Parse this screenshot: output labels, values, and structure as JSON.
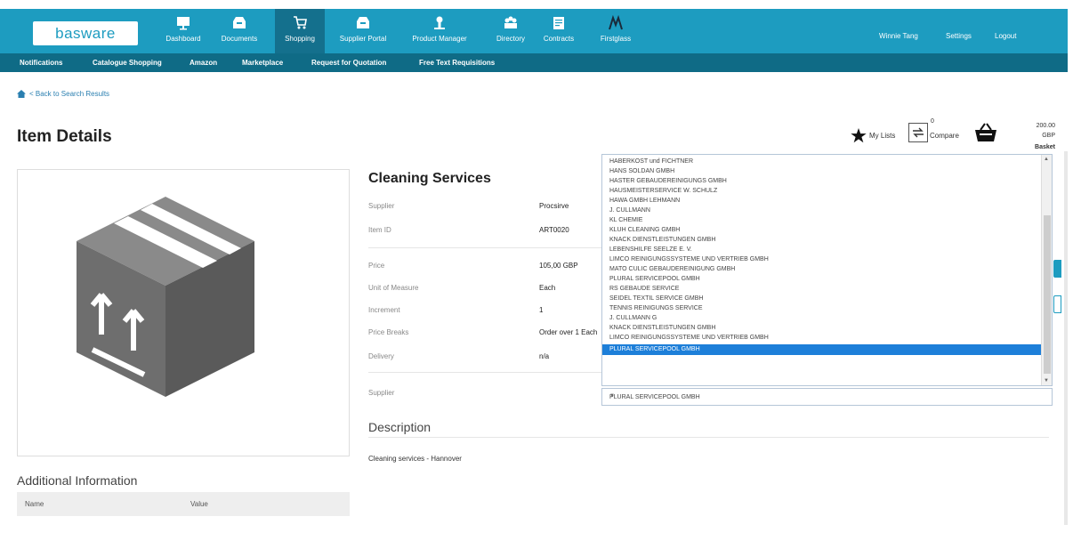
{
  "app": {
    "logo": "basware",
    "nav": [
      {
        "label": "Dashboard",
        "icon": "monitor-icon"
      },
      {
        "label": "Documents",
        "icon": "inbox-icon"
      },
      {
        "label": "Shopping",
        "icon": "cart-icon"
      },
      {
        "label": "Supplier Portal",
        "icon": "inbox-icon"
      },
      {
        "label": "Product Manager",
        "icon": "person-icon"
      },
      {
        "label": "Directory",
        "icon": "people-icon"
      },
      {
        "label": "Contracts",
        "icon": "document-icon"
      },
      {
        "label": "Firstglass",
        "icon": "logo-icon"
      }
    ],
    "user": "Winnie Tang",
    "settings": "Settings",
    "logout": "Logout"
  },
  "subnav": [
    "Notifications",
    "Catalogue Shopping",
    "Amazon",
    "Marketplace",
    "Request for Quotation",
    "Free Text Requisitions"
  ],
  "breadcrumb": "< Back to Search Results",
  "page_title": "Item Details",
  "toolbar": {
    "my_lists": "My Lists",
    "compare": "Compare",
    "compare_count": "0",
    "basket_amount": "200.00 GBP",
    "basket_label": "Basket"
  },
  "item": {
    "title": "Cleaning Services",
    "details": [
      {
        "label": "Supplier",
        "value": "Procsirve"
      },
      {
        "label": "Item ID",
        "value": "ART0020"
      },
      {
        "label": "Price",
        "value": "105,00 GBP"
      },
      {
        "label": "Unit of Measure",
        "value": "Each"
      },
      {
        "label": "Increment",
        "value": "1"
      },
      {
        "label": "Price Breaks",
        "value": "Order over 1 Each"
      },
      {
        "label": "Delivery",
        "value": "n/a"
      },
      {
        "label": "Supplier",
        "value": ""
      }
    ],
    "description_title": "Description",
    "description": "Cleaning services - Hannover"
  },
  "additional_info": {
    "title": "Additional Information",
    "columns": [
      "Name",
      "Value"
    ]
  },
  "supplier_dropdown": {
    "options": [
      "HABERKOST und FICHTNER",
      "HANS SOLDAN GMBH",
      "HASTER GEBAUDEREINIGUNGS GMBH",
      "HAUSMEISTERSERVICE W. SCHULZ",
      "HAWA GMBH LEHMANN",
      "J. CULLMANN",
      "KL CHEMIE",
      "KLUH CLEANING GMBH",
      "KNACK DIENSTLEISTUNGEN GMBH",
      "LEBENSHILFE SEELZE E. V.",
      "LIMCO REINIGUNGSSYSTEME UND VERTRIEB GMBH",
      "MATO CULIC GEBAUDEREINIGUNG GMBH",
      "PLURAL SERVICEPOOL GMBH",
      "RS GEBAUDE SERVICE",
      "SEIDEL TEXTIL SERVICE GMBH",
      "TENNIS REINIGUNGS SERVICE",
      "J. CULLMANN G",
      "KNACK DIENSTLEISTUNGEN GMBH",
      "LIMCO REINIGUNGSSYSTEME UND VERTRIEB GMBH",
      "PLURAL SERVICEPOOL GMBH"
    ],
    "selected_index": 19,
    "selected_value": "PLURAL SERVICEPOOL GMBH"
  },
  "colors": {
    "header": "#1d9cc0",
    "subnav": "#0f6b86",
    "selection": "#1d7fd9"
  }
}
